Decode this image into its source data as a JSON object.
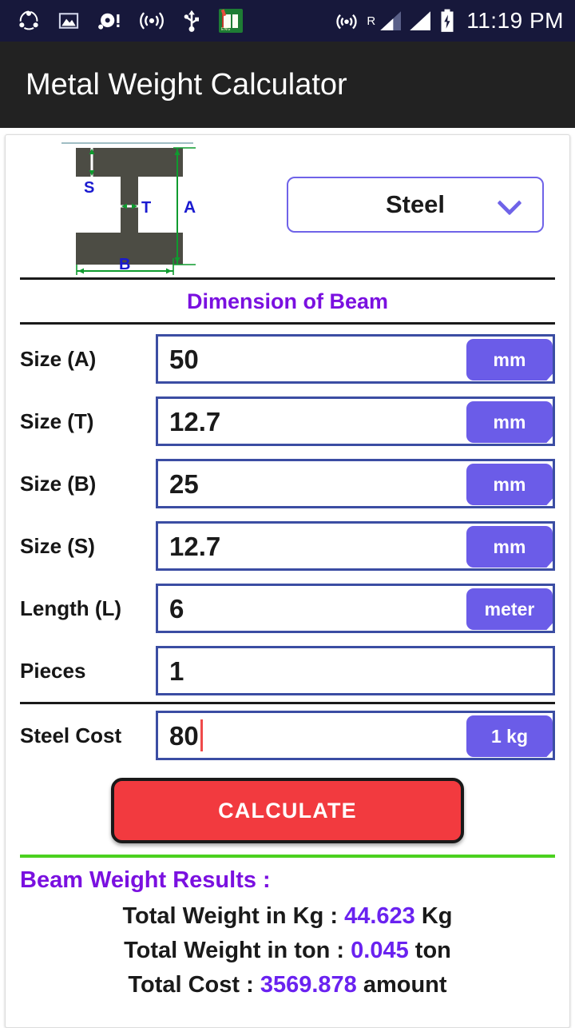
{
  "statusbar": {
    "icons_left": [
      "share-icon",
      "gallery-image-icon",
      "alarm-alert-icon",
      "wifi-broadcast-icon",
      "usb-icon",
      "dictionary-book-icon"
    ],
    "book_icon_caption": "ENG",
    "roaming_label": "R",
    "icons_right": [
      "hotspot-icon",
      "signal-bars-roaming-icon",
      "signal-bars-icon",
      "battery-charging-icon"
    ],
    "time": "11:19 PM"
  },
  "appbar": {
    "title": "Metal Weight Calculator"
  },
  "diagram": {
    "labels": {
      "s": "S",
      "t": "T",
      "a": "A",
      "b": "B"
    },
    "colors": {
      "beam": "#4c4c44",
      "dim_blue": "#1a1ad0",
      "dim_green": "#0f9b2f"
    }
  },
  "material": {
    "selected": "Steel",
    "chevron": "chevron-down-icon"
  },
  "section": {
    "heading": "Dimension of Beam"
  },
  "fields": [
    {
      "label": "Size (A)",
      "value": "50",
      "unit": "mm",
      "has_unit": true,
      "caret": false
    },
    {
      "label": "Size (T)",
      "value": "12.7",
      "unit": "mm",
      "has_unit": true,
      "caret": false
    },
    {
      "label": "Size (B)",
      "value": "25",
      "unit": "mm",
      "has_unit": true,
      "caret": false
    },
    {
      "label": "Size (S)",
      "value": "12.7",
      "unit": "mm",
      "has_unit": true,
      "caret": false
    },
    {
      "label": "Length (L)",
      "value": "6",
      "unit": "meter",
      "has_unit": true,
      "caret": false
    },
    {
      "label": "Pieces",
      "value": "1",
      "unit": "",
      "has_unit": false,
      "caret": false
    },
    {
      "label": "Steel Cost",
      "value": "80",
      "unit": "1 kg",
      "has_unit": true,
      "caret": true
    }
  ],
  "calculate": {
    "label": "CALCULATE"
  },
  "results": {
    "title": "Beam Weight Results :",
    "lines": [
      {
        "prefix": "Total Weight in Kg : ",
        "value": "44.623",
        "suffix": " Kg"
      },
      {
        "prefix": "Total Weight in ton : ",
        "value": "0.045",
        "suffix": " ton"
      },
      {
        "prefix": "Total Cost : ",
        "value": "3569.878",
        "suffix": " amount"
      }
    ]
  },
  "colors": {
    "accent_purple": "#6b5ce8",
    "heading_purple": "#7a10e0",
    "value_purple": "#6a22f0",
    "field_border": "#3b4da3",
    "calculate_red": "#f23a3f",
    "divider_green": "#4bd11f",
    "statusbar_bg": "#17183b",
    "appbar_bg": "#222222"
  }
}
